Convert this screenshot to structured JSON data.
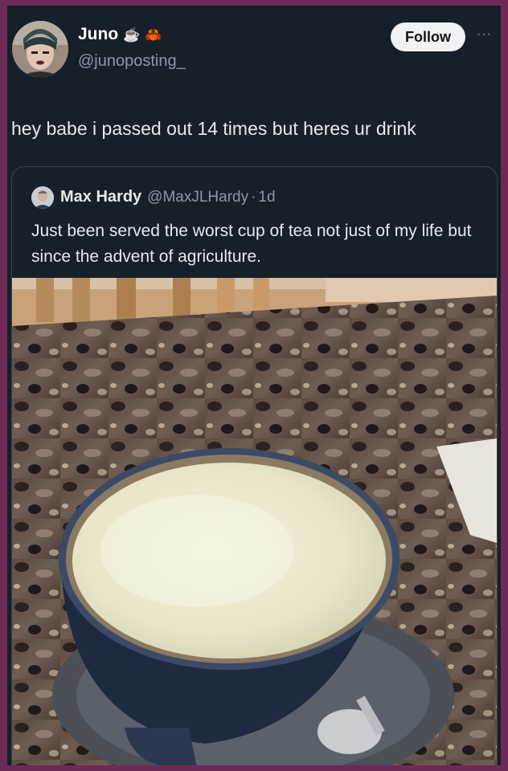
{
  "author": {
    "name": "Juno",
    "emoji": [
      "☕",
      "🦀"
    ],
    "handle": "@junoposting_",
    "follow_label": "Follow",
    "more_label": "···"
  },
  "tweet": {
    "text": "hey babe i passed out 14 times but heres ur drink"
  },
  "quoted": {
    "name": "Max Hardy",
    "handle": "@MaxJLHardy",
    "separator": "·",
    "time": "1d",
    "text": "Just been served the worst cup of tea not just of my life but since the advent of agriculture."
  },
  "icons": [
    "avatar",
    "more-icon",
    "coffee-emoji",
    "crab-emoji",
    "quoted-avatar"
  ],
  "colors": {
    "background": "#15202b",
    "border": "#6e2a57",
    "text": "#e7e9ea",
    "secondary_text": "#8b98a5",
    "follow_bg": "#eff3f4"
  }
}
